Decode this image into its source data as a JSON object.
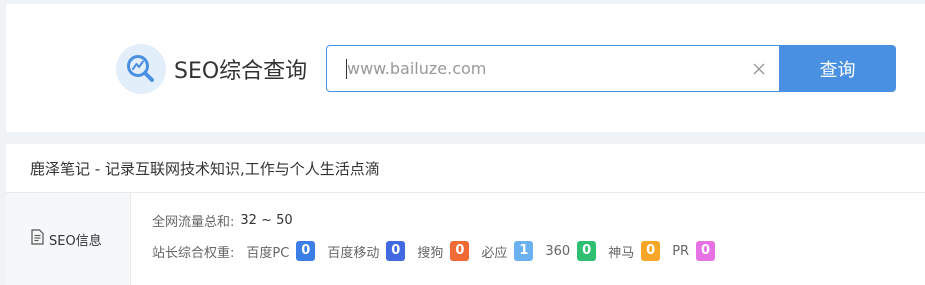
{
  "app": {
    "title": "SEO综合查询",
    "logo_icon": "chart-magnifier-icon",
    "accent_color": "#4a90e2"
  },
  "search": {
    "placeholder": "www.bailuze.com",
    "value": "",
    "clear_icon": "close-icon",
    "button_label": "查询"
  },
  "site": {
    "title": "鹿泽笔记 - 记录互联网技术知识,工作与个人生活点滴"
  },
  "seo_info": {
    "label": "SEO信息",
    "icon": "document-icon",
    "traffic_label": "全网流量总和:",
    "traffic_value": "32 ~ 50",
    "weights_label": "站长综合权重:",
    "weights": [
      {
        "name": "百度PC",
        "value": "0",
        "color": "#3b7fe6"
      },
      {
        "name": "百度移动",
        "value": "0",
        "color": "#4169e1"
      },
      {
        "name": "搜狗",
        "value": "0",
        "color": "#f06a35"
      },
      {
        "name": "必应",
        "value": "1",
        "color": "#69b1f0"
      },
      {
        "name": "360",
        "value": "0",
        "color": "#2fbf71"
      },
      {
        "name": "神马",
        "value": "0",
        "color": "#f7a628"
      },
      {
        "name": "PR",
        "value": "0",
        "color": "#e772e3"
      }
    ]
  }
}
